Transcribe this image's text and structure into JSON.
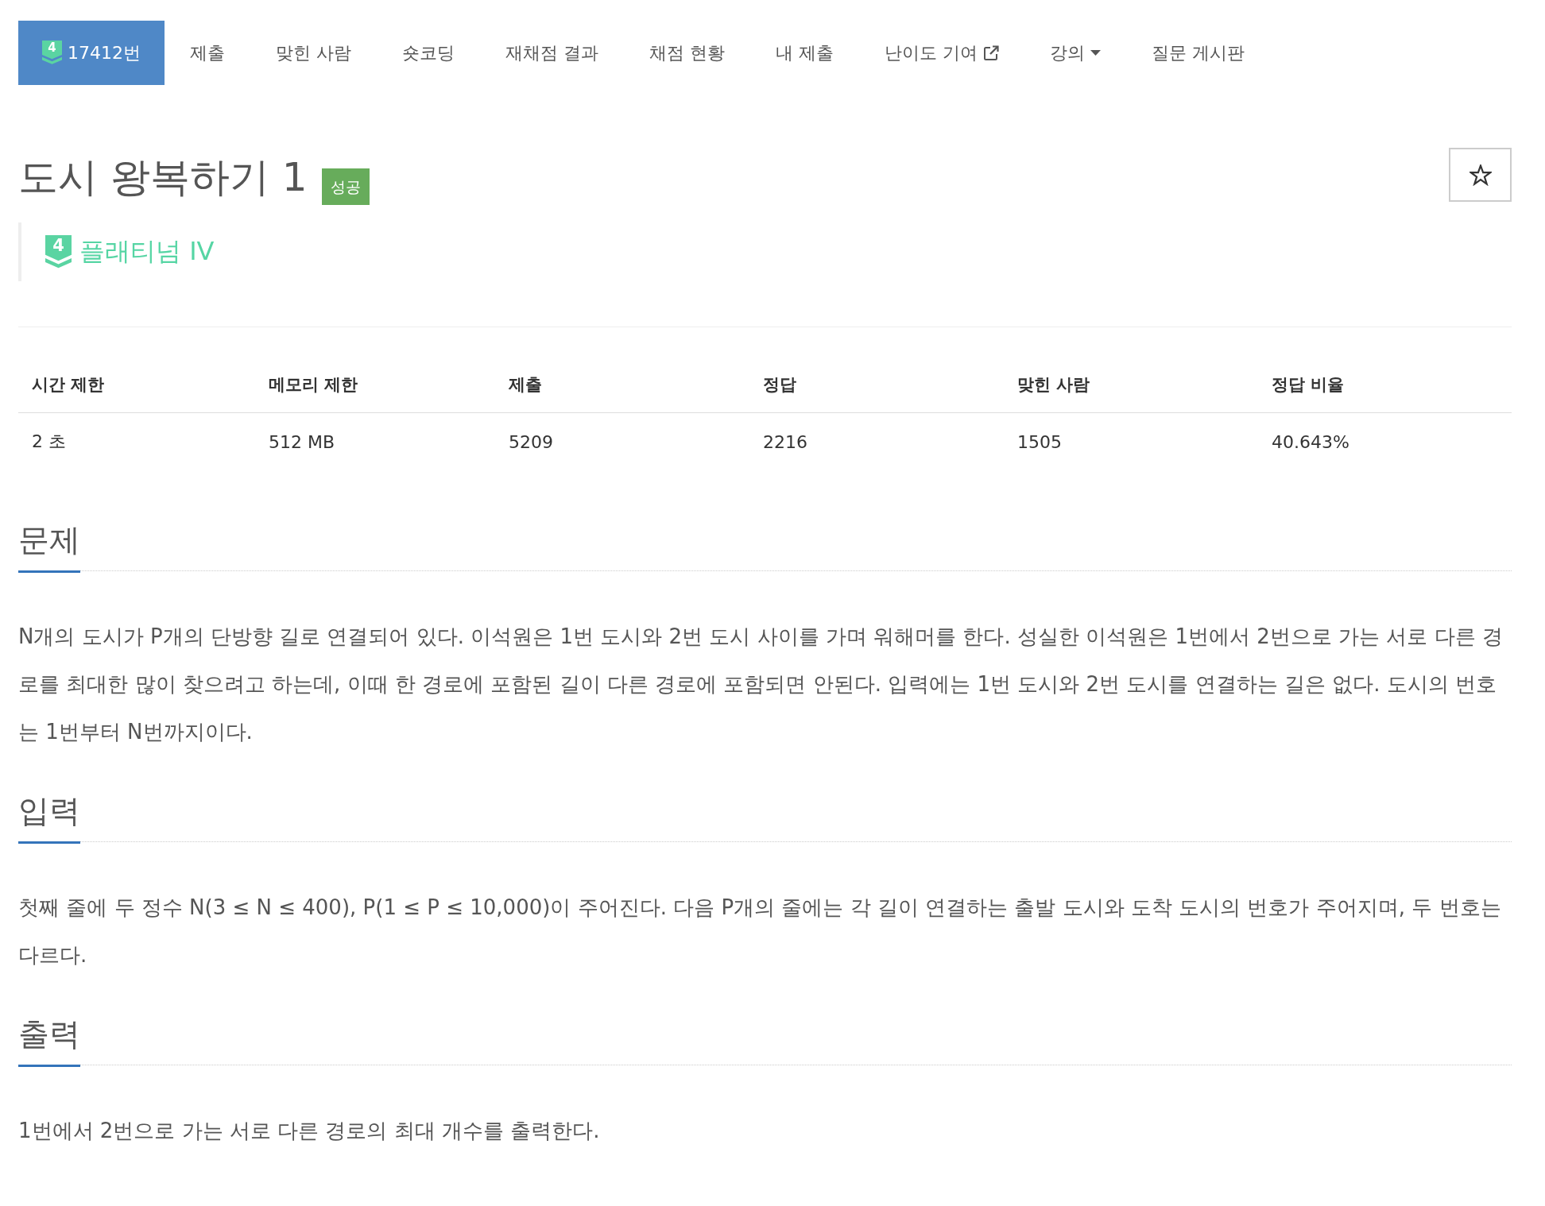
{
  "nav": {
    "tabs": [
      {
        "kind": "problem",
        "label": "17412번",
        "tier_badge": "4",
        "selected": true
      },
      {
        "kind": "link",
        "label": "제출",
        "selected": false
      },
      {
        "kind": "link",
        "label": "맞힌 사람",
        "selected": false
      },
      {
        "kind": "link",
        "label": "숏코딩",
        "selected": false
      },
      {
        "kind": "link",
        "label": "재채점 결과",
        "selected": false
      },
      {
        "kind": "link",
        "label": "채점 현황",
        "selected": false
      },
      {
        "kind": "link",
        "label": "내 제출",
        "selected": false
      },
      {
        "kind": "external",
        "label": "난이도 기여",
        "selected": false
      },
      {
        "kind": "dropdown",
        "label": "강의",
        "selected": false
      },
      {
        "kind": "link",
        "label": "질문 게시판",
        "selected": false
      }
    ]
  },
  "problem": {
    "title": "도시 왕복하기 1",
    "status": "성공",
    "starred": false
  },
  "tier": {
    "badge": "4",
    "name": "플래티넘 IV"
  },
  "stats": {
    "columns": [
      "시간 제한",
      "메모리 제한",
      "제출",
      "정답",
      "맞힌 사람",
      "정답 비율"
    ],
    "rows": [
      [
        "2 초",
        "512 MB",
        "5209",
        "2216",
        "1505",
        "40.643%"
      ]
    ]
  },
  "sections": [
    {
      "heading": "문제",
      "paragraphs": [
        "N개의 도시가 P개의 단방향 길로 연결되어 있다. 이석원은 1번 도시와 2번 도시 사이를 가며 워해머를 한다. 성실한 이석원은 1번에서 2번으로 가는 서로 다른 경로를 최대한 많이 찾으려고 하는데, 이때 한 경로에 포함된 길이 다른 경로에 포함되면 안된다. 입력에는 1번 도시와 2번 도시를 연결하는 길은 없다. 도시의 번호는 1번부터 N번까지이다."
      ]
    },
    {
      "heading": "입력",
      "paragraphs": [
        "첫째 줄에 두 정수 N(3 ≤ N ≤ 400), P(1 ≤ P ≤ 10,000)이 주어진다. 다음 P개의 줄에는 각 길이 연결하는 출발 도시와 도착 도시의 번호가 주어지며, 두 번호는 다르다."
      ]
    },
    {
      "heading": "출력",
      "paragraphs": [
        "1번에서 2번으로 가는 서로 다른 경로의 최대 개수를 출력한다."
      ]
    }
  ]
}
